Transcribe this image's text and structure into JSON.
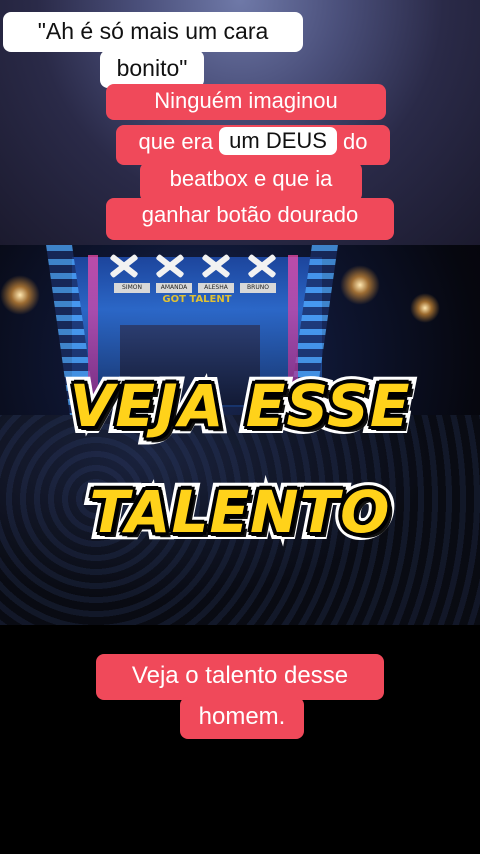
{
  "captions_top": {
    "white_line1": "\"Ah é só mais um cara",
    "white_line2": "bonito\"",
    "red_line1": "Ninguém imaginou",
    "red_line2_before": "que era",
    "red_line2_highlight": "um DEUS",
    "red_line2_after": "do",
    "red_line3": "beatbox e que ia",
    "red_line4": "ganhar botão dourado"
  },
  "stage": {
    "judges": [
      "SIMON",
      "AMANDA",
      "ALESHA",
      "BRUNO"
    ],
    "show_logo": "GOT TALENT"
  },
  "headline": {
    "line1": "VEJA ESSE",
    "line2": "TALENTO"
  },
  "caption_bottom": {
    "line1": "Veja o talento desse",
    "line2": "homem."
  },
  "colors": {
    "caption_red": "#f0495a",
    "caption_white": "#ffffff",
    "headline_yellow": "#ffd21a"
  }
}
